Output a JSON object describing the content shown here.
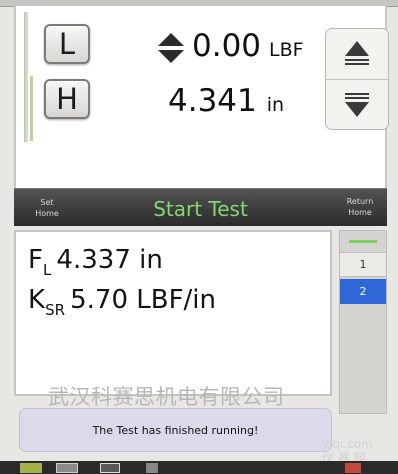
{
  "controls": {
    "limit_low_label": "L",
    "limit_high_label": "H"
  },
  "readouts": {
    "force_value": "0.00",
    "force_unit": "LBF",
    "displacement_value": "4.341",
    "displacement_unit": "in"
  },
  "toolbar": {
    "set_home": [
      "Set",
      "Home"
    ],
    "start_test": "Start Test",
    "return_home": [
      "Return",
      "Home"
    ]
  },
  "results": {
    "fl_symbol": "F",
    "fl_sub": "L",
    "fl_value": "4.337 in",
    "ksr_symbol": "K",
    "ksr_sub": "SR",
    "ksr_value": "5.70 LBF/in"
  },
  "test_list": {
    "items": [
      "1",
      "2"
    ],
    "selected": "2"
  },
  "message": "The Test has finished running!",
  "watermark": {
    "company": "武汉科赛思机电有限公司",
    "site": "yiqi.com",
    "site_cn": "仪 器 网"
  },
  "colors": {
    "start_text": "#84d86f",
    "selected_item": "#2f66d8",
    "message_bg": "#dcdaea"
  },
  "icons": {
    "up_down_indicator": "up-down-arrows-icon",
    "increase": "up-arrow-icon",
    "decrease": "down-arrow-icon"
  }
}
